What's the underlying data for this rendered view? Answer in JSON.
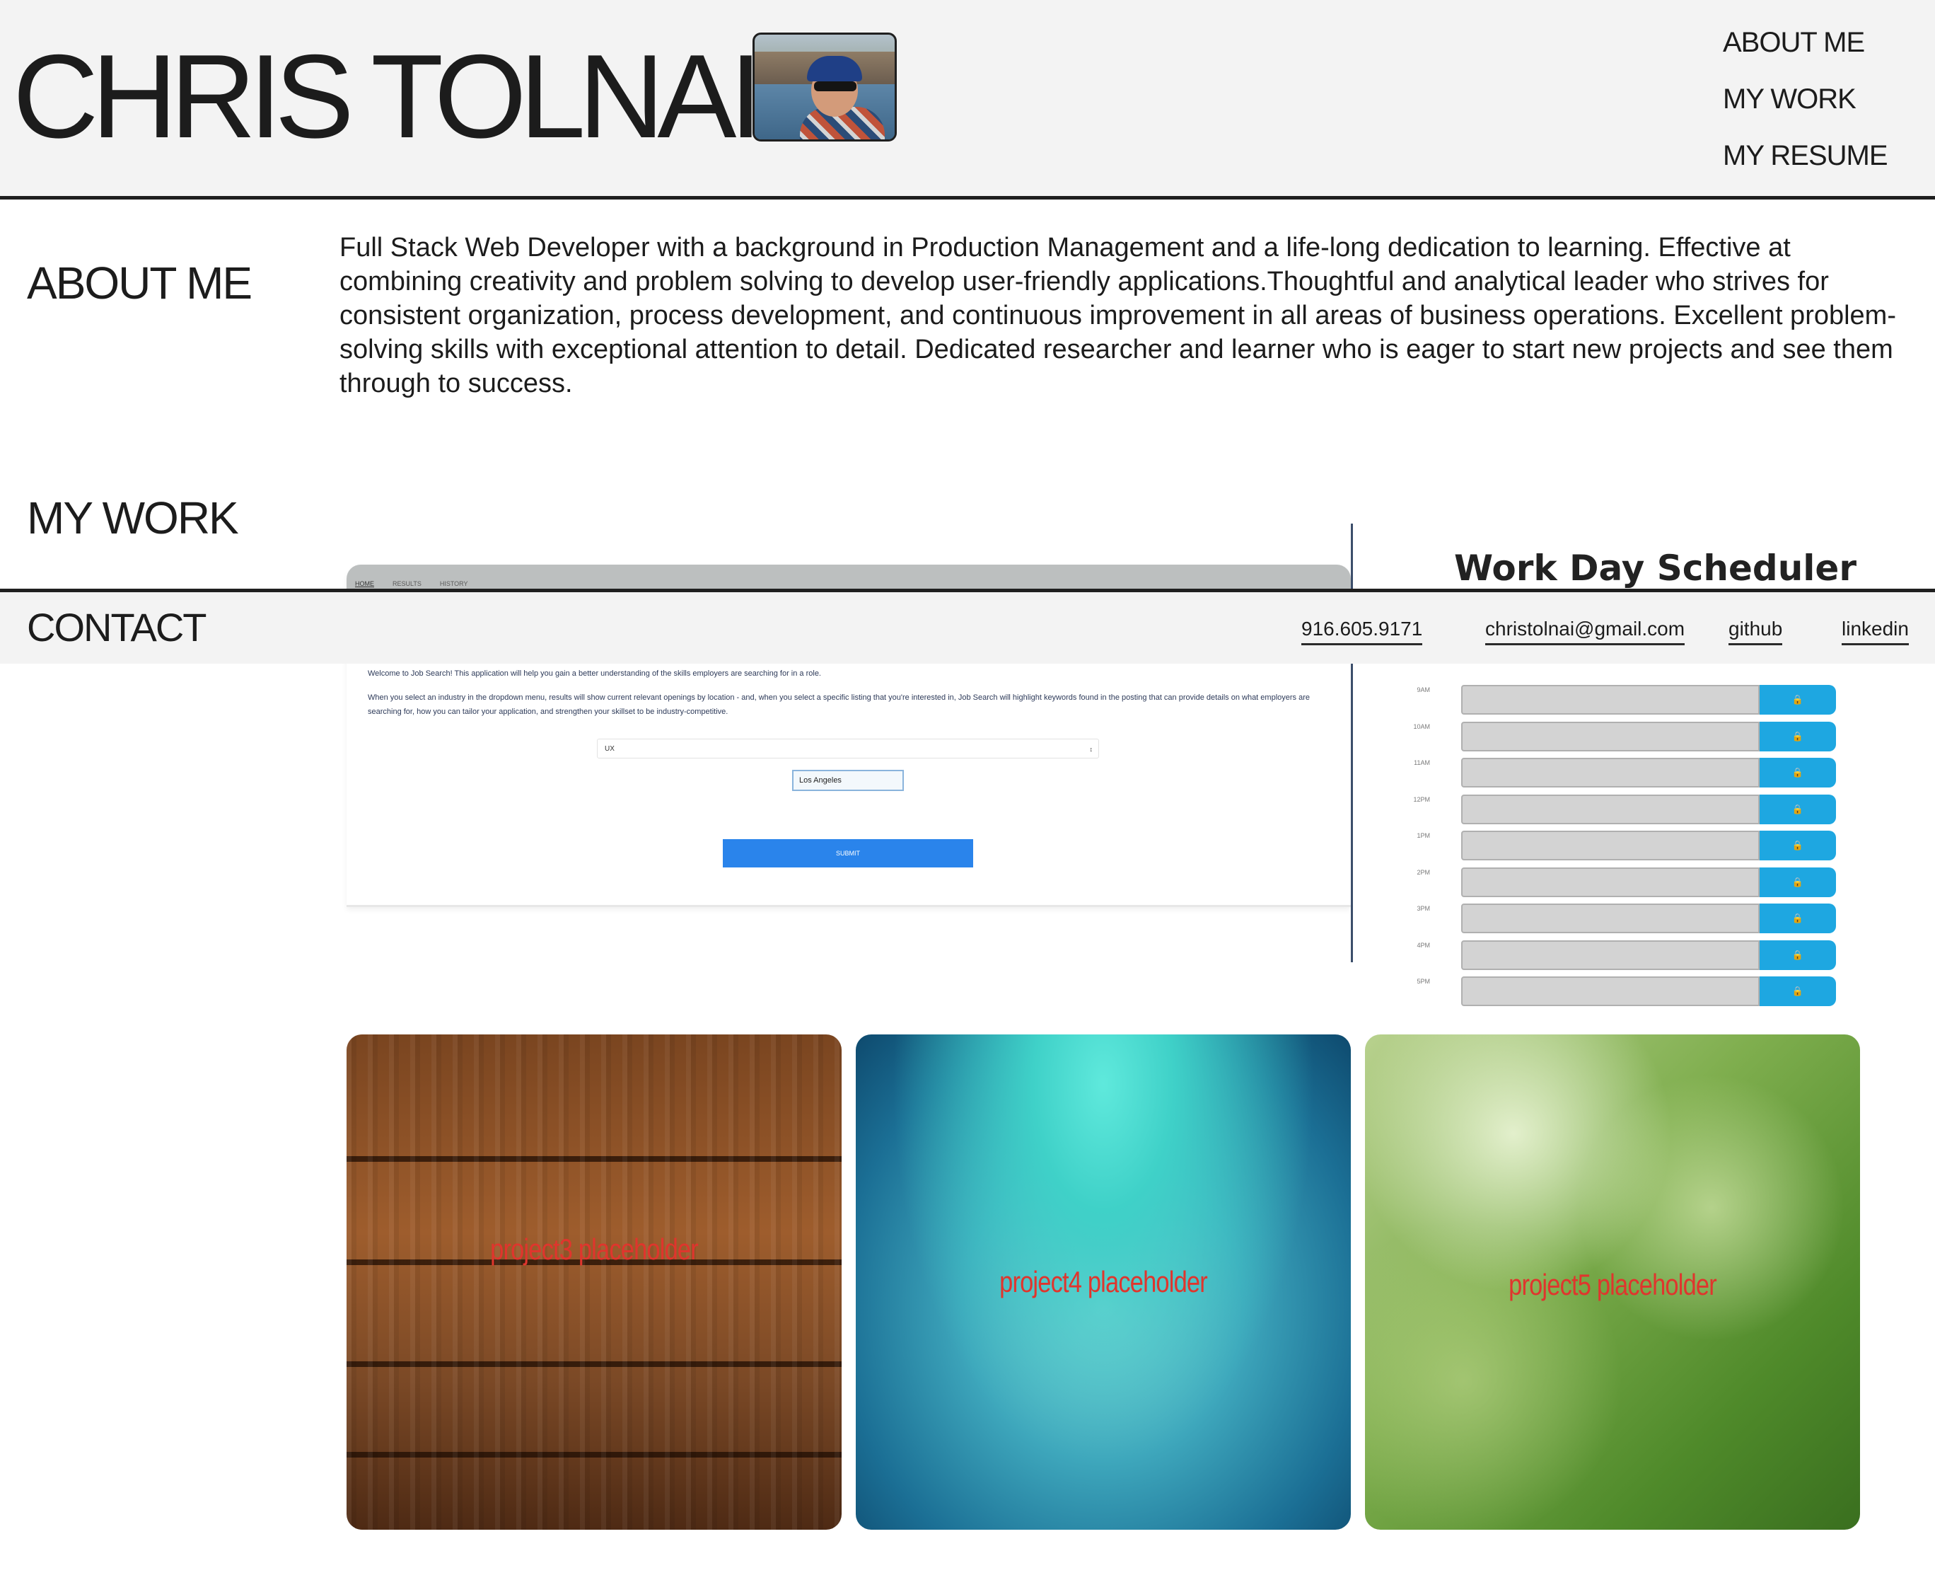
{
  "header": {
    "title": "CHRIS TOLNAI",
    "nav": [
      "ABOUT ME",
      "MY WORK",
      "MY RESUME"
    ]
  },
  "about": {
    "heading": "ABOUT ME",
    "text": "Full Stack Web Developer with a background in Production Management and a life-long dedication to learning. Effective at combining creativity and problem solving to develop user-friendly applications.Thoughtful and analytical leader who strives for consistent organization, process development, and continuous improvement in all areas of business operations. Excellent problem-solving skills with exceptional attention to detail. Dedicated researcher and learner who is eager to start new projects and see them through to success."
  },
  "work": {
    "heading": "MY WORK",
    "project1": {
      "tabs": [
        "HOME",
        "RESULTS",
        "HISTORY"
      ],
      "intro": "Welcome to Job Search! This application will help you gain a better understanding of the skills employers are searching for in a role.",
      "detail": "When you select an industry in the dropdown menu, results will show current relevant openings by location - and, when you select a specific listing that you're interested in, Job Search will highlight keywords found in the posting that can provide details on what employers are searching for, how you can tailor your application, and strengthen your skillset to be industry-competitive.",
      "select_value": "UX",
      "select_arrow": "↕",
      "location_value": "Los Angeles",
      "submit_label": "SUBMIT"
    },
    "project2": {
      "title": "Work Day Scheduler",
      "hours": [
        "9AM",
        "10AM",
        "11AM",
        "12PM",
        "1PM",
        "2PM",
        "3PM",
        "4PM",
        "5PM"
      ],
      "save_icon": "🔒"
    },
    "placeholders": [
      "project3 placeholder",
      "project4 placeholder",
      "project5 placeholder"
    ]
  },
  "contact": {
    "heading": "CONTACT",
    "phone": "916.605.9171",
    "email": "christolnai@gmail.com",
    "github": "github",
    "linkedin": "linkedin"
  },
  "colors": {
    "header_bg": "#f3f3f3",
    "rule": "#1f1f1f",
    "submit_blue": "#2a84eb",
    "save_blue": "#1ea7e1",
    "placeholder_text": "#e0352d"
  }
}
